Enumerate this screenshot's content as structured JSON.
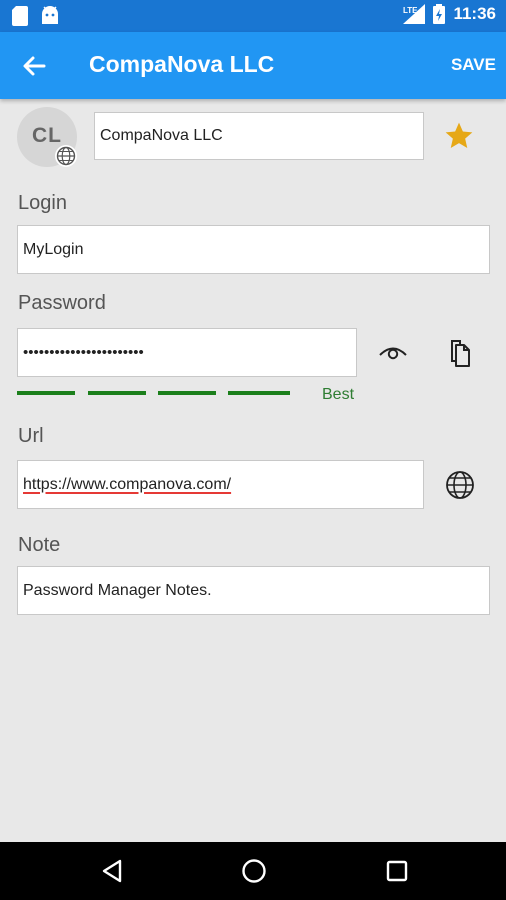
{
  "status_bar": {
    "time": "11:36",
    "network": "LTE"
  },
  "app_bar": {
    "title": "CompaNova LLC",
    "save_label": "SAVE"
  },
  "avatar": {
    "initials": "CL"
  },
  "entry": {
    "name_value": "CompaNova LLC",
    "login_label": "Login",
    "login_value": "MyLogin",
    "password_label": "Password",
    "password_value": "•••••••••••••••••••••••",
    "strength_label": "Best",
    "url_label": "Url",
    "url_value": "https://www.companova.com/",
    "note_label": "Note",
    "note_value": "Password Manager Notes."
  },
  "colors": {
    "primary": "#2196f3",
    "primary_dark": "#1976d2",
    "star": "#e6a817",
    "strength": "#1b7f1b"
  },
  "icons": [
    "sd-card-icon",
    "android-icon",
    "signal-icon",
    "battery-icon",
    "back-arrow-icon",
    "globe-icon",
    "star-icon",
    "eye-icon",
    "copy-icon",
    "back-triangle-icon",
    "home-circle-icon",
    "recents-square-icon"
  ]
}
